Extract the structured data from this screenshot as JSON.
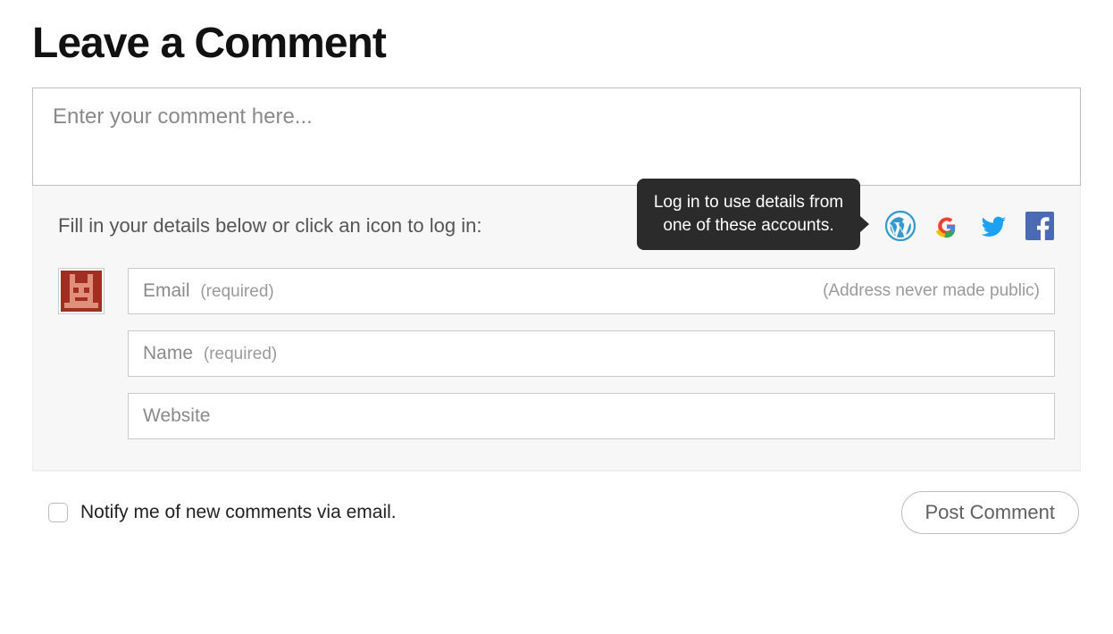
{
  "heading": "Leave a Comment",
  "comment": {
    "placeholder": "Enter your comment here..."
  },
  "details": {
    "instructions": "Fill in your details below or click an icon to log in:",
    "tooltip": "Log in to use details from one of these accounts.",
    "social": {
      "wordpress": "wordpress-icon",
      "google": "google-icon",
      "twitter": "twitter-icon",
      "facebook": "facebook-icon"
    }
  },
  "fields": {
    "email": {
      "label": "Email",
      "hint": "(required)",
      "right": "(Address never made public)"
    },
    "name": {
      "label": "Name",
      "hint": "(required)"
    },
    "website": {
      "label": "Website"
    }
  },
  "footer": {
    "notify_label": "Notify me of new comments via email.",
    "submit_label": "Post Comment"
  }
}
